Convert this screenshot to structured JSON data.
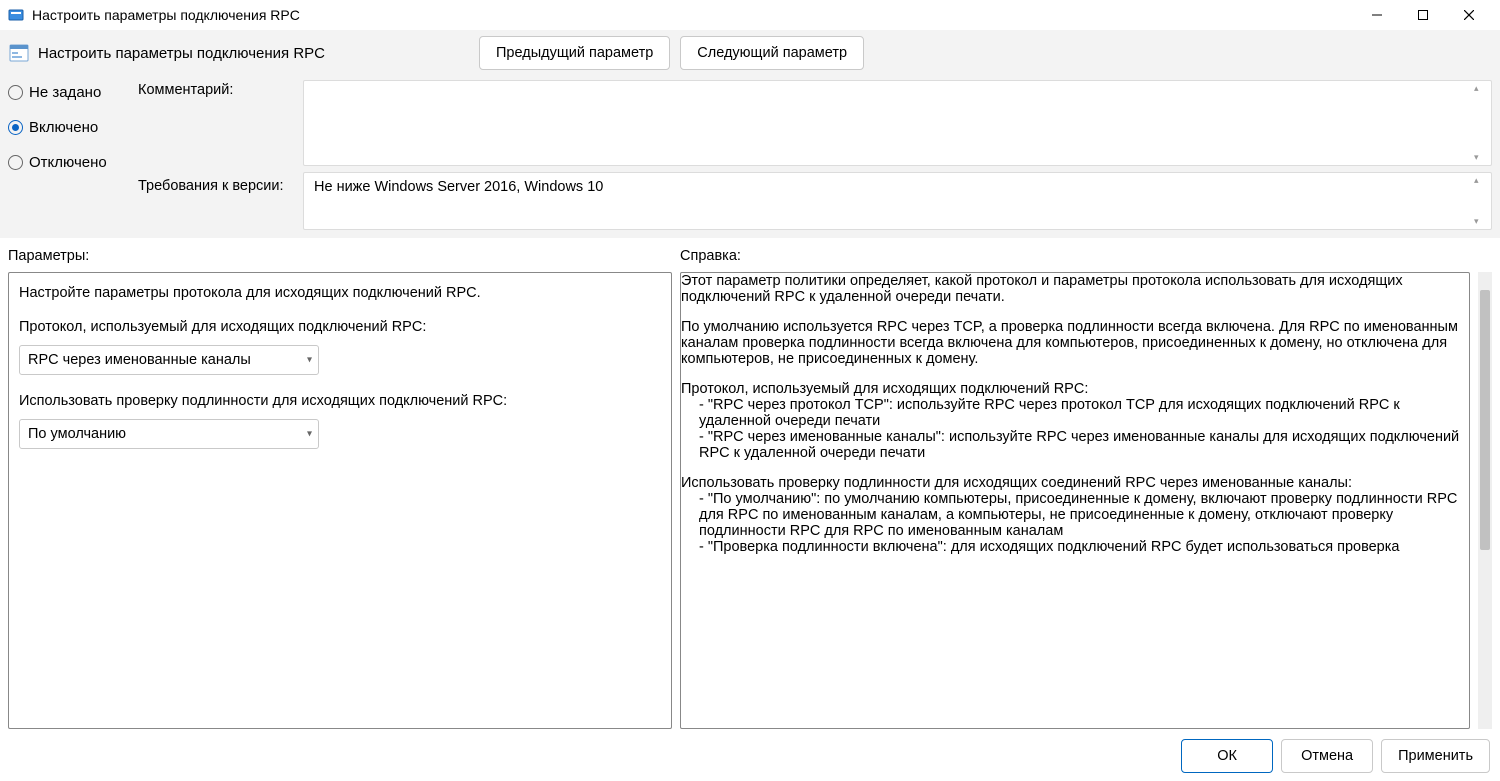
{
  "titlebar": {
    "title": "Настроить параметры подключения RPC"
  },
  "header": {
    "page_title": "Настроить параметры подключения RPC",
    "prev_btn": "Предыдущий параметр",
    "next_btn": "Следующий параметр"
  },
  "state": {
    "not_configured": "Не задано",
    "enabled": "Включено",
    "disabled": "Отключено",
    "selected": "enabled"
  },
  "labels": {
    "comment": "Комментарий:",
    "supported": "Требования к версии:",
    "options": "Параметры:",
    "help": "Справка:"
  },
  "fields": {
    "comment_value": "",
    "supported_value": "Не ниже Windows Server 2016, Windows 10"
  },
  "options": {
    "heading": "Настройте параметры протокола для исходящих подключений RPC.",
    "protocol_label": "Протокол, используемый для исходящих подключений RPC:",
    "protocol_value": "RPC через именованные каналы",
    "auth_label": "Использовать проверку подлинности для исходящих подключений RPC:",
    "auth_value": "По умолчанию"
  },
  "help": {
    "p1": "Этот параметр политики определяет, какой протокол и параметры протокола использовать для исходящих подключений RPC к удаленной очереди печати.",
    "p2": "По умолчанию используется RPC через TCP, а проверка подлинности всегда включена. Для RPC по именованным каналам проверка подлинности всегда включена для компьютеров, присоединенных к домену, но отключена для компьютеров, не присоединенных к домену.",
    "p3": "Протокол, используемый для исходящих подключений RPC:",
    "p3a": "- \"RPC через протокол TCP\": используйте RPC через протокол TCP для исходящих подключений RPC к удаленной очереди печати",
    "p3b": "- \"RPC через именованные каналы\": используйте RPC через именованные каналы для исходящих подключений RPC к удаленной очереди печати",
    "p4": "Использовать проверку подлинности для исходящих соединений RPC через именованные каналы:",
    "p4a": "- \"По умолчанию\": по умолчанию компьютеры, присоединенные к домену, включают проверку подлинности RPC для RPC по именованным каналам, а компьютеры, не присоединенные к домену, отключают проверку подлинности RPC для RPC по именованным каналам",
    "p4b": "- \"Проверка подлинности включена\": для исходящих подключений RPC будет использоваться проверка"
  },
  "footer": {
    "ok": "ОК",
    "cancel": "Отмена",
    "apply": "Применить"
  }
}
